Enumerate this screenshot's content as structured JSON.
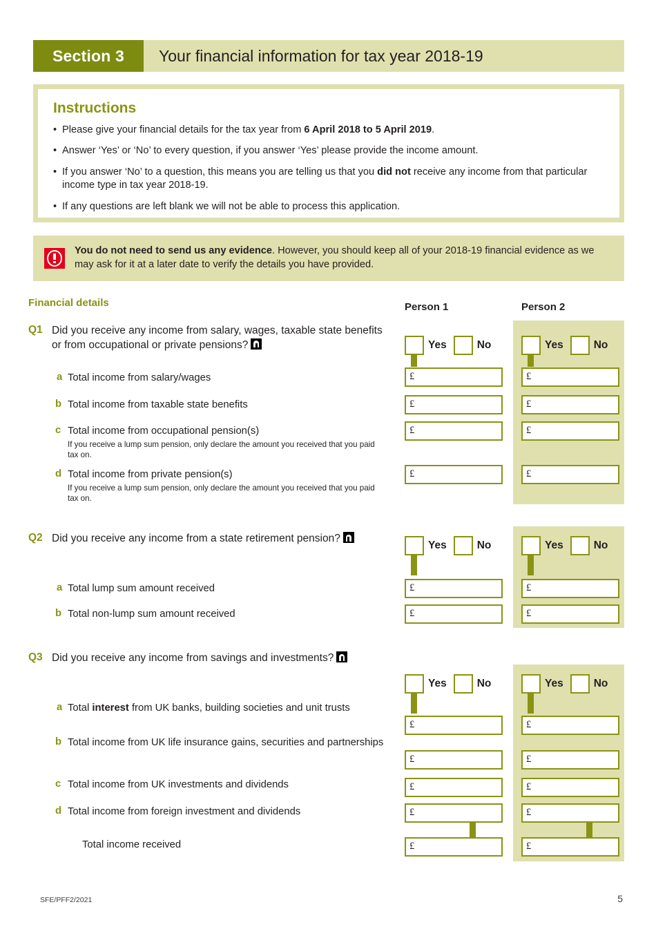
{
  "header": {
    "section_tag": "Section 3",
    "title": "Your financial information for tax year 2018-19"
  },
  "instructions": {
    "heading": "Instructions",
    "bullet_char": "•",
    "items": [
      {
        "pre": "Please give your financial details for the tax year from ",
        "bold": "6 April 2018 to 5 April 2019",
        "post": "."
      },
      {
        "pre": "Answer ‘Yes’ or ‘No’ to every question, if you answer ‘Yes’ please provide the income amount.",
        "bold": "",
        "post": ""
      },
      {
        "pre": "If you answer ‘No’ to a question, this means you are telling us that you ",
        "bold": "did not",
        "post": " receive any income from that particular income type in tax year 2018-19."
      },
      {
        "pre": "If any questions are left blank we will not be able to process this application.",
        "bold": "",
        "post": ""
      }
    ]
  },
  "notice": {
    "icon": "exclamation-icon",
    "bold": "You do not need to send us any evidence",
    "rest": ". However, you should keep all of your 2018-19 financial evidence as we may ask for it at a later date to verify the details you have provided."
  },
  "columns": {
    "financial_details": "Financial details",
    "person1": "Person 1",
    "person2": "Person 2"
  },
  "answers": {
    "yes": "Yes",
    "no": "No"
  },
  "currency_symbol": "£",
  "questions": [
    {
      "num": "Q1",
      "text": "Did you receive any income from salary, wages, taxable state benefits or from occupational or private pensions?",
      "has_notes_icon": true,
      "subs": [
        {
          "letter": "a",
          "text": "Total income from salary/wages",
          "bold": "",
          "text_after": "",
          "hint": ""
        },
        {
          "letter": "b",
          "text": "Total income from taxable state benefits",
          "bold": "",
          "text_after": "",
          "hint": ""
        },
        {
          "letter": "c",
          "text": "Total income from occupational pension(s)",
          "bold": "",
          "text_after": "",
          "hint": "If you receive a lump sum pension, only declare the amount you received that you paid tax on."
        },
        {
          "letter": "d",
          "text": "Total income from private pension(s)",
          "bold": "",
          "text_after": "",
          "hint": "If you receive a lump sum pension, only declare the amount you received that you paid tax on."
        }
      ]
    },
    {
      "num": "Q2",
      "text": "Did you receive any income from a state retirement pension?",
      "has_notes_icon": true,
      "subs": [
        {
          "letter": "a",
          "text": "Total lump sum amount received",
          "bold": "",
          "text_after": "",
          "hint": ""
        },
        {
          "letter": "b",
          "text": "Total non-lump sum amount received",
          "bold": "",
          "text_after": "",
          "hint": ""
        }
      ]
    },
    {
      "num": "Q3",
      "text": "Did you receive any income from savings and investments?",
      "has_notes_icon": true,
      "subs": [
        {
          "letter": "a",
          "text": "Total ",
          "bold": "interest",
          "text_after": " from UK banks, building societies and unit trusts",
          "hint": ""
        },
        {
          "letter": "b",
          "text": "Total income from UK life insurance gains, securities and partnerships",
          "bold": "",
          "text_after": "",
          "hint": ""
        },
        {
          "letter": "c",
          "text": "Total income from UK investments and dividends",
          "bold": "",
          "text_after": "",
          "hint": ""
        },
        {
          "letter": "d",
          "text": "Total income from foreign investment and dividends",
          "bold": "",
          "text_after": "",
          "hint": ""
        }
      ],
      "total_label": "Total income received"
    }
  ],
  "footer": {
    "reference": "SFE/PFF2/2021",
    "page_number": "5"
  },
  "colors": {
    "dark_olive": "#7d8c11",
    "mid_olive": "#8a9314",
    "light_olive": "#dfe0ae",
    "red": "#e2001a",
    "text": "#231f20"
  }
}
